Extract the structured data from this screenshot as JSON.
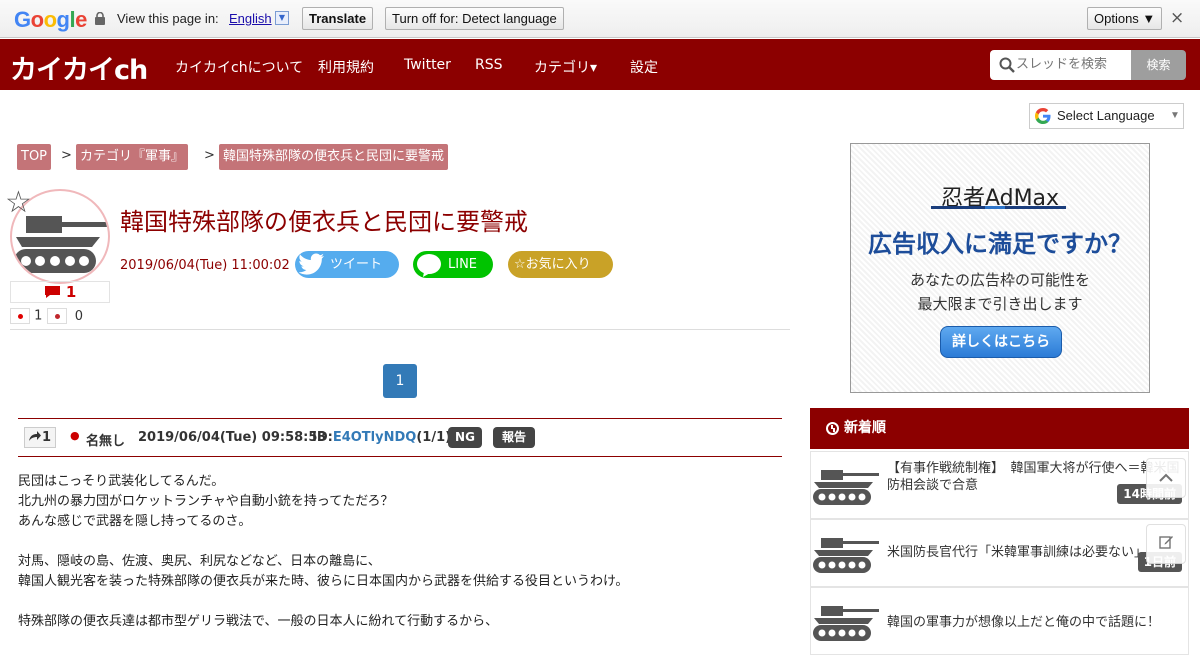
{
  "translate_bar": {
    "logo_letters": [
      {
        "ch": "G",
        "color": "#4285f4"
      },
      {
        "ch": "o",
        "color": "#ea4335"
      },
      {
        "ch": "o",
        "color": "#fbbc05"
      },
      {
        "ch": "g",
        "color": "#4285f4"
      },
      {
        "ch": "l",
        "color": "#34a853"
      },
      {
        "ch": "e",
        "color": "#ea4335"
      }
    ],
    "view_text": "View this page in:",
    "language": "English",
    "dropdown_glyph": "▼",
    "translate_label": "Translate",
    "turn_off_label": "Turn off for: Detect language",
    "options_label": "Options ▼",
    "close_glyph": "×"
  },
  "header": {
    "logo": "カイカイch",
    "nav": [
      "カイカイchについて",
      "利用規約",
      "Twitter",
      "RSS",
      "カテゴリ▾",
      "設定"
    ],
    "search_placeholder": "スレッドを検索",
    "search_button": "検索",
    "brand_color": "#8c0000"
  },
  "select_language": {
    "label": "Select Language",
    "arrow": "▼"
  },
  "breadcrumb": {
    "items": [
      "TOP",
      "カテゴリ『軍事』",
      "韓国特殊部隊の便衣兵と民団に要警戒"
    ],
    "separator": ">"
  },
  "thread": {
    "star_glyph": "☆",
    "comment_count": "1",
    "flags": [
      {
        "country": "japan",
        "count": "1",
        "dot_color": "#e00000"
      },
      {
        "country": "korea",
        "count": "0",
        "dot_color": "#c0272d"
      }
    ],
    "title": "韓国特殊部隊の便衣兵と民団に要警戒",
    "date": "2019/06/04(Tue) 11:00:02",
    "tweet_label": "ツイート",
    "line_label": "LINE",
    "fav_label": "☆お気に入り"
  },
  "pagination": {
    "current": "1"
  },
  "post": {
    "number": "1",
    "name": "名無し",
    "date": "2019/06/04(Tue) 09:58:53",
    "id_label": "ID:",
    "id": "E4OTlyNDQ",
    "id_count": "(1/1)",
    "ng_label": "NG",
    "report_label": "報告",
    "lines": [
      "民団はこっそり武装化してるんだ。",
      "北九州の暴力団がロケットランチャや自動小銃を持ってただろ？",
      "あんな感じで武器を隠し持ってるのさ。",
      "",
      "対馬、隠岐の島、佐渡、奥尻、利尻などなど、日本の離島に、",
      "韓国人観光客を装った特殊部隊の便衣兵が来た時、彼らに日本国内から武器を供給する役目というわけ。",
      "",
      "特殊部隊の便衣兵達は都市型ゲリラ戦法で、一般の日本人に紛れて行動するから、"
    ]
  },
  "ad": {
    "brand": "忍者AdMax",
    "headline": "広告収入に満足ですか？",
    "sub1": "あなたの広告枠の可能性を",
    "sub2": "最大限まで引き出します",
    "button": "詳しくはこちら"
  },
  "sidebar": {
    "heading": "新着順",
    "items": [
      {
        "text": "【有事作戦統制権】　韓国軍大将が行使へ＝韓米国防相会談で合意",
        "time": "14時間前"
      },
      {
        "text": "米国防長官代行「米韓軍事訓練は必要ない」",
        "time": "1日前"
      },
      {
        "text": "韓国の軍事力が想像以上だと俺の中で話題に！",
        "time": ""
      }
    ]
  }
}
